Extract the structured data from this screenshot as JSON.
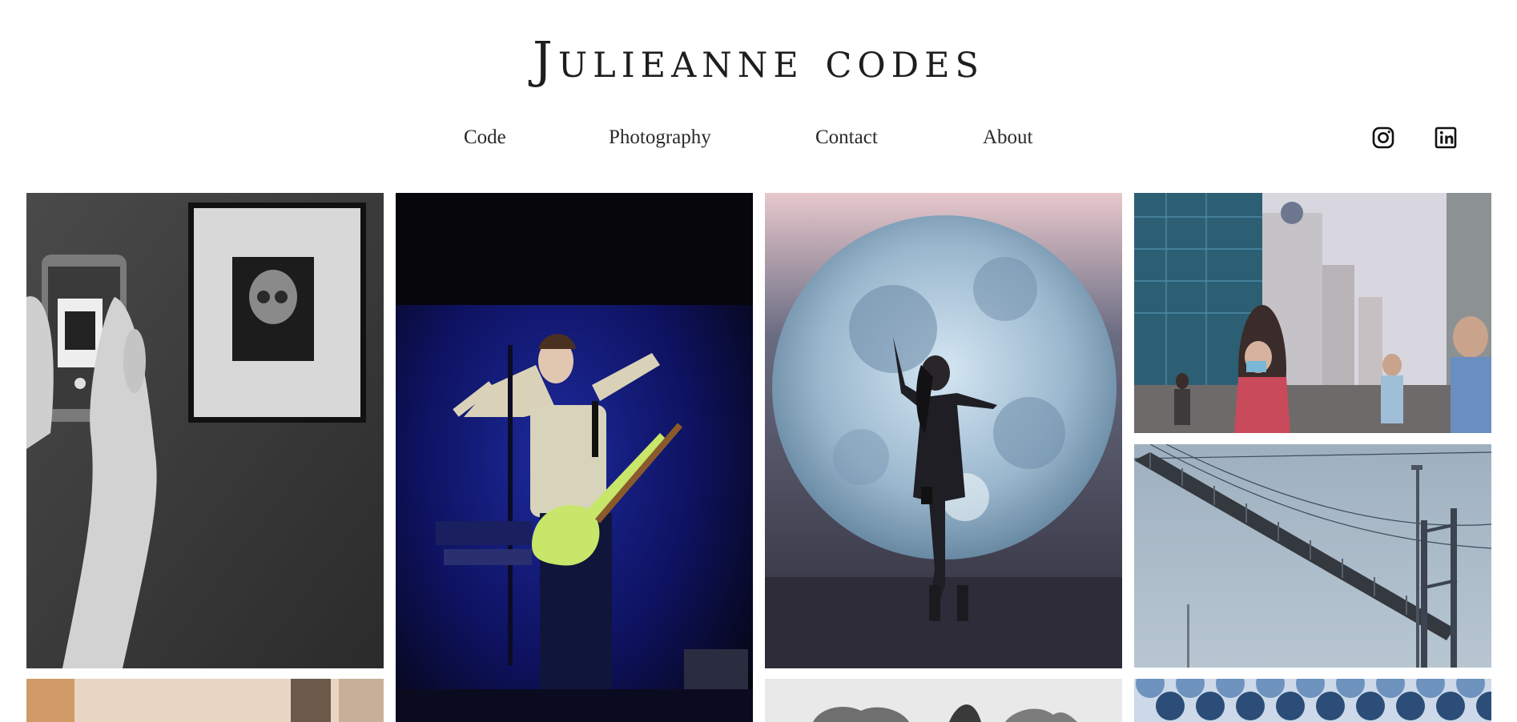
{
  "site": {
    "title": "Julieanne codes"
  },
  "nav": {
    "items": [
      "Code",
      "Photography",
      "Contact",
      "About"
    ]
  },
  "social": {
    "icons": [
      "instagram-icon",
      "linkedin-icon"
    ]
  }
}
